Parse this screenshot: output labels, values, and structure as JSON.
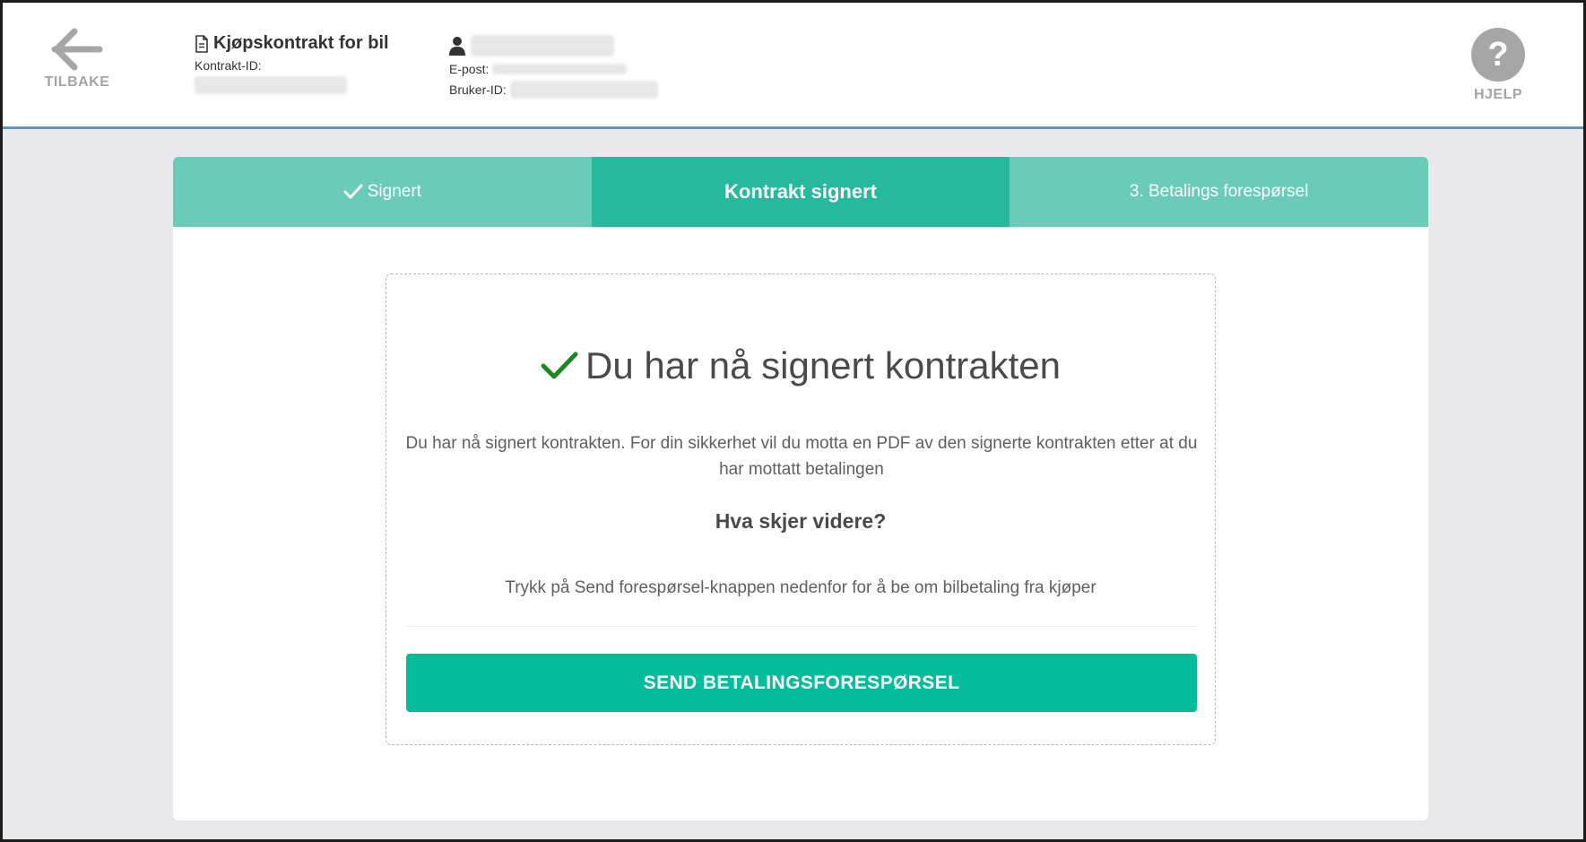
{
  "header": {
    "back_label": "TILBAKE",
    "contract_title": "Kjøpskontrakt for bil",
    "contract_id_label": "Kontrakt-ID:",
    "email_label": "E-post:",
    "user_id_label": "Bruker-ID:",
    "help_symbol": "?",
    "help_label": "HJELP",
    "icons": {
      "back": "arrow-left-icon",
      "document": "document-icon",
      "user": "user-icon",
      "help": "question-mark-icon"
    }
  },
  "steps": [
    {
      "label": "Signert",
      "state": "done",
      "icon": "checkmark-icon"
    },
    {
      "label": "Kontrakt signert",
      "state": "active"
    },
    {
      "label": "3. Betalings forespørsel",
      "state": "upcoming"
    }
  ],
  "main": {
    "title": "Du har nå signert kontrakten",
    "description": "Du har nå signert kontrakten. For din sikkerhet vil du motta en PDF av den signerte kontrakten etter at du har mottatt betalingen",
    "subheading": "Hva skjer videre?",
    "instruction": "Trykk på Send forespørsel-knappen nedenfor for å be om bilbetaling fra kjøper",
    "button_label": "SEND BETALINGSFORESPØRSEL"
  },
  "colors": {
    "accent": "#05bc9c",
    "step_active": "#27b99e",
    "step_inactive": "#6acbb8",
    "success_check": "#1a8a1f",
    "header_border": "#5c9bb5",
    "page_bg": "#e9e9eb"
  }
}
